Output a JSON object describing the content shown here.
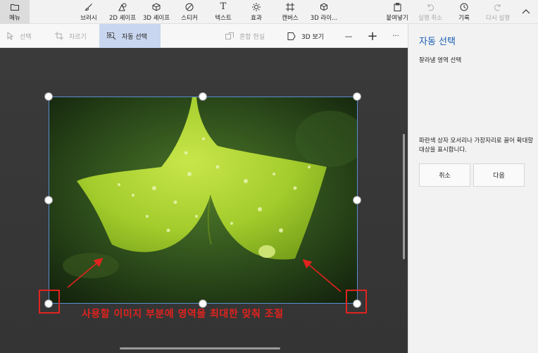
{
  "toolbar": {
    "menu": "메뉴",
    "brush": "브러시",
    "shapes2d": "2D 셰이프",
    "shapes3d": "3D 셰이프",
    "sticker": "스티커",
    "text": "텍스트",
    "effects": "효과",
    "canvas": "캔버스",
    "library3d": "3D 라이...",
    "paste": "붙여넣기",
    "undo": "실행 취소",
    "history": "기록",
    "redo": "다시 실행"
  },
  "subtoolbar": {
    "select": "선택",
    "crop": "자르기",
    "magic_select": "자동 선택",
    "mixed_reality": "혼합 현실",
    "view3d": "3D 보기",
    "zoom_out": "—",
    "zoom_in": "+",
    "more": "···"
  },
  "panel": {
    "title": "자동 선택",
    "subtitle": "잘라낼 영역 선택",
    "description": "파란색 상자 모서리나 가장자리로 끌어 확대할 대상을 표시합니다.",
    "cancel": "취소",
    "next": "다음"
  },
  "annotation": {
    "caption": "사용할 이미지 부분에 영역을 최대한 맞춰 조절"
  },
  "colors": {
    "accent": "#1a5fb4",
    "selection": "#5a8fd4",
    "annotation": "#e0231e",
    "active_tool": "#c9d6ef"
  }
}
